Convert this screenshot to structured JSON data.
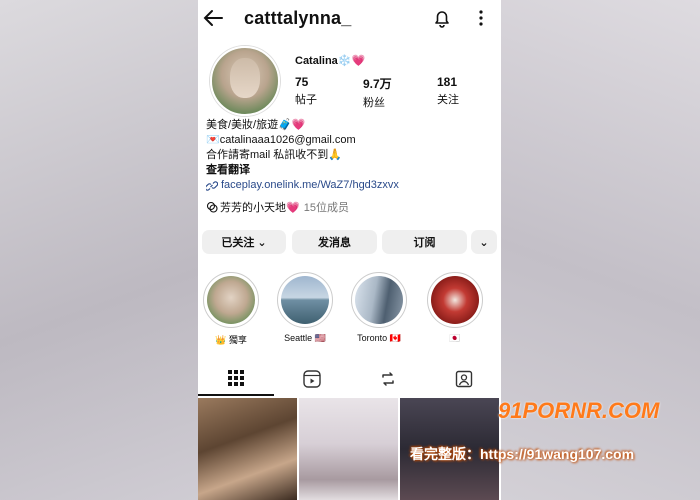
{
  "header": {
    "username": "catttalynna_",
    "back_icon": "arrow-left-icon",
    "bell_icon": "bell-icon",
    "more_icon": "more-vertical-icon"
  },
  "profile": {
    "display_name": "Catalina❄️💗",
    "stats": [
      {
        "value": "75",
        "label": "帖子"
      },
      {
        "value": "9.7万",
        "label": "粉丝"
      },
      {
        "value": "181",
        "label": "关注"
      }
    ],
    "bio_lines": [
      "美食/美妝/旅遊🧳💗",
      "💌catalinaaa1026@gmail.com",
      "合作請寄mail 私訊收不到🙏"
    ],
    "translate_label": "查看翻译",
    "link": "faceplay.onelink.me/WaZ7/hgd3zxvx",
    "channel_name": "芳芳的小天地💗",
    "channel_members": "15位成员"
  },
  "actions": {
    "following": "已关注 ⌄",
    "message": "发消息",
    "subscribe": "订阅",
    "expand": "⌄"
  },
  "highlights": [
    {
      "caption": "👑 獨享"
    },
    {
      "caption": "Seattle 🇺🇸"
    },
    {
      "caption": "Toronto 🇨🇦"
    },
    {
      "caption": "🇯🇵"
    }
  ],
  "tabs": [
    "grid-icon",
    "reels-icon",
    "repost-icon",
    "tagged-icon"
  ],
  "watermark": {
    "site": "91PORNR.COM",
    "text": "看完整版：https://91wang107.com"
  }
}
